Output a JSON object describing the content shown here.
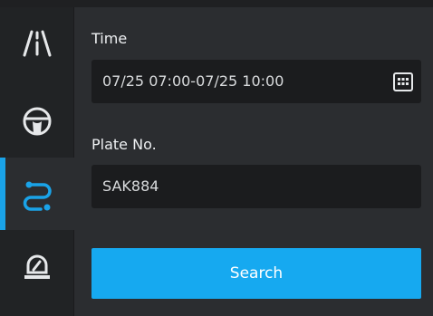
{
  "sidebar": {
    "items": [
      {
        "name": "road",
        "icon": "road-icon",
        "active": false
      },
      {
        "name": "vehicle",
        "icon": "steering-wheel-icon",
        "active": false
      },
      {
        "name": "route",
        "icon": "route-icon",
        "active": true
      },
      {
        "name": "alarm",
        "icon": "alarm-light-icon",
        "active": false
      }
    ]
  },
  "form": {
    "time_label": "Time",
    "time_value": "07/25 07:00-07/25 10:00",
    "plate_label": "Plate No.",
    "plate_value": "SAK884",
    "search_label": "Search"
  },
  "colors": {
    "accent": "#16a9f0",
    "sidebar_bg": "#212325",
    "panel_bg": "#2b2d30",
    "field_bg": "#1b1c1e"
  }
}
